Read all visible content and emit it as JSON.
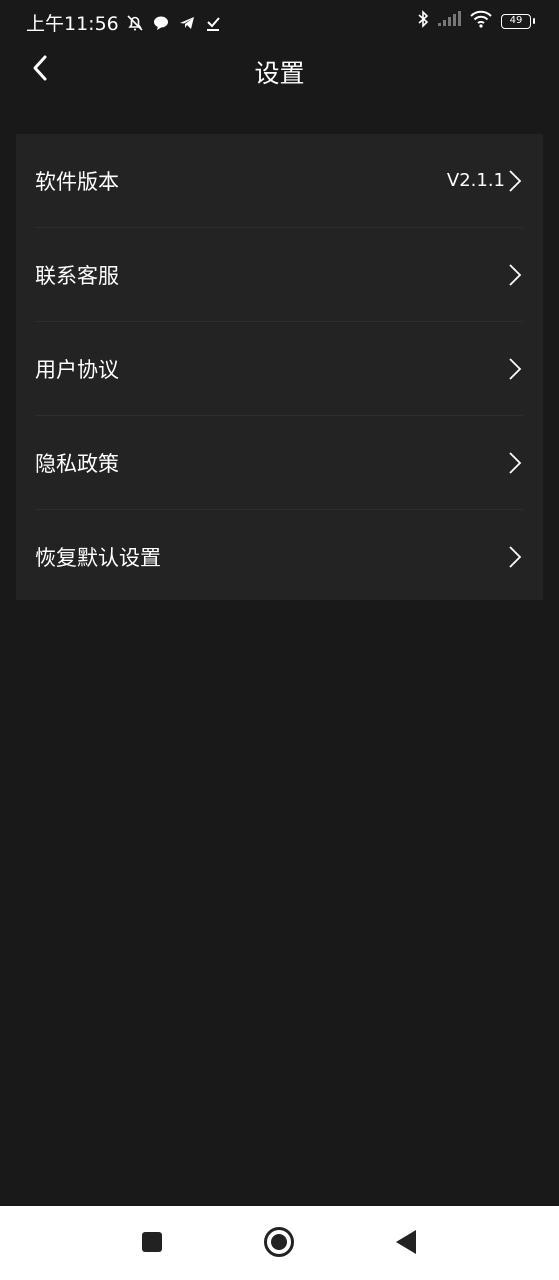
{
  "status_bar": {
    "time": "上午11:56",
    "battery": "49",
    "left_icons": [
      "alarm-off-icon",
      "chat-icon",
      "telegram-icon",
      "download-done-icon"
    ],
    "right_icons": [
      "bluetooth-icon",
      "signal-icon",
      "wifi-icon",
      "battery-icon"
    ]
  },
  "header": {
    "title": "设置",
    "back_icon": "chevron-left-icon"
  },
  "settings": {
    "items": [
      {
        "label": "软件版本",
        "value": "V2.1.1"
      },
      {
        "label": "联系客服",
        "value": ""
      },
      {
        "label": "用户协议",
        "value": ""
      },
      {
        "label": "隐私政策",
        "value": ""
      },
      {
        "label": "恢复默认设置",
        "value": ""
      }
    ]
  },
  "nav_bar": {
    "buttons": [
      "recents-square-icon",
      "home-circle-icon",
      "back-triangle-icon"
    ]
  },
  "colors": {
    "background": "#191919",
    "card": "#232323",
    "divider": "#2e2e2e",
    "text": "#ffffff",
    "nav_background": "#ffffff",
    "nav_icon": "#222222"
  }
}
